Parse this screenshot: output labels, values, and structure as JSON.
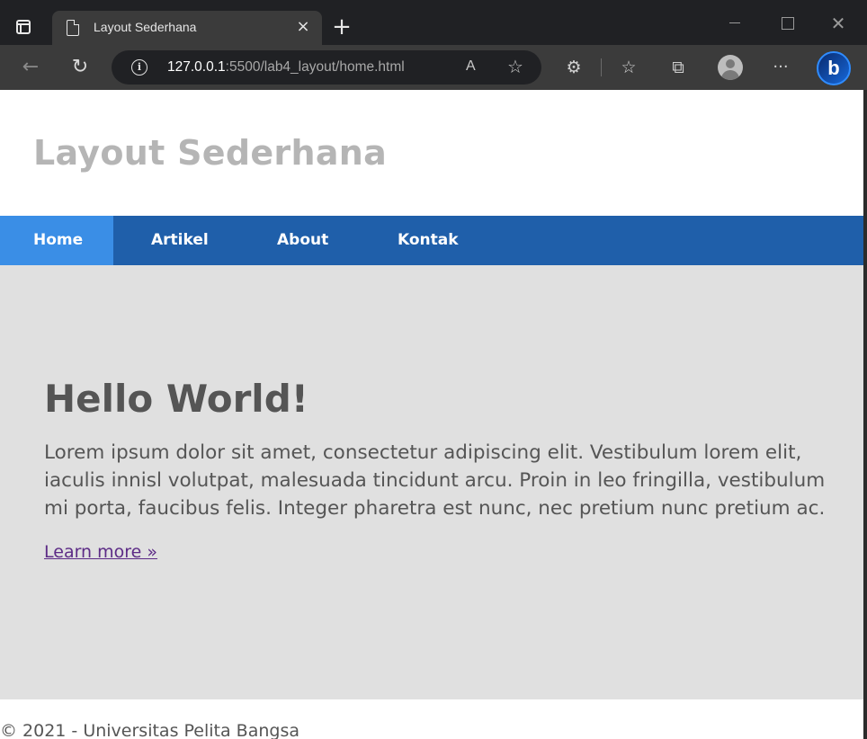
{
  "browser": {
    "tab_title": "Layout Sederhana",
    "tab_close_glyph": "×",
    "new_tab_glyph": "+",
    "close_window_glyph": "✕",
    "back_glyph": "←",
    "reload_glyph": "↻",
    "url_host": "127.0.0.1",
    "url_path": ":5500/lab4_layout/home.html",
    "info_glyph": "i",
    "read_aloud_glyph": "A",
    "favorite_add_glyph": "☆",
    "extensions_glyph": "⚙",
    "favorites_glyph": "☆",
    "collections_glyph": "⧉",
    "more_glyph": "···",
    "bing_glyph": "b"
  },
  "site": {
    "title": "Layout Sederhana",
    "nav": [
      {
        "label": "Home",
        "active": true
      },
      {
        "label": "Artikel",
        "active": false
      },
      {
        "label": "About",
        "active": false
      },
      {
        "label": "Kontak",
        "active": false
      }
    ],
    "hero": {
      "heading": "Hello World!",
      "body": "Lorem ipsum dolor sit amet, consectetur adipiscing elit. Vestibulum lorem elit, iaculis innisl volutpat, malesuada tincidunt arcu. Proin in leo fringilla, vestibulum mi porta, faucibus felis. Integer pharetra est nunc, nec pretium nunc pretium ac.",
      "link": "Learn more »"
    },
    "footer": "© 2021 - Universitas Pelita Bangsa"
  },
  "colors": {
    "nav_bg": "#1f5faa",
    "nav_active_bg": "#3a8ee6",
    "hero_bg": "#e0e0e0",
    "title_text": "#b5b5b5",
    "body_text": "#555555",
    "link_text": "#5c2b86"
  },
  "icons": {
    "tab_actions": "tab-actions-icon",
    "page": "page-icon",
    "back": "back-arrow-icon",
    "reload": "reload-icon",
    "info": "info-icon",
    "read_aloud": "read-aloud-icon",
    "favorite_add": "add-favorite-icon",
    "extensions": "extensions-icon",
    "favorites": "favorites-icon",
    "collections": "collections-icon",
    "profile": "profile-avatar-icon",
    "more": "more-menu-icon",
    "bing": "bing-copilot-icon"
  }
}
